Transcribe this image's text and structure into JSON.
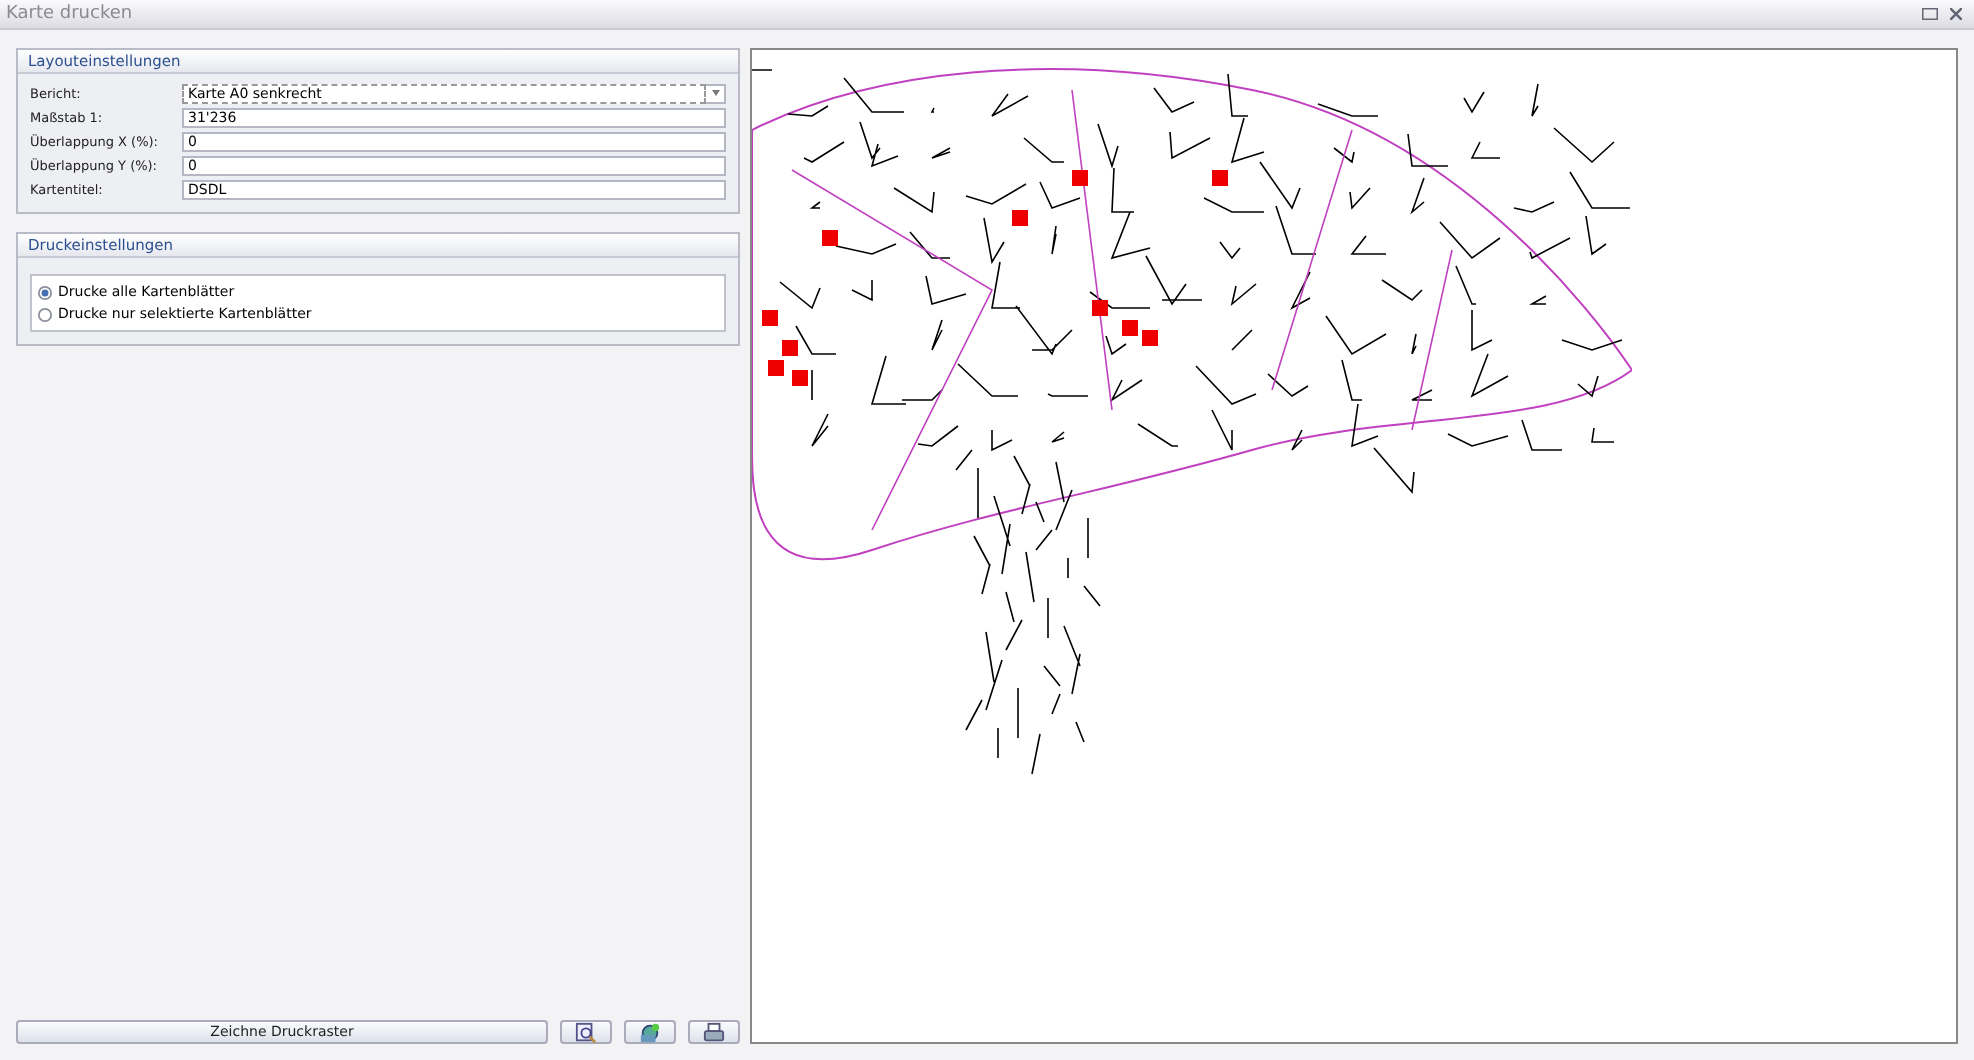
{
  "window": {
    "title": "Karte drucken"
  },
  "layout_settings": {
    "title": "Layouteinstellungen",
    "fields": [
      {
        "kind": "dropdown",
        "label": "Bericht:",
        "value": "Karte A0 senkrecht"
      },
      {
        "kind": "text",
        "label": "Maßstab 1:",
        "value": "31'236"
      },
      {
        "kind": "text",
        "label": "Überlappung X (%):",
        "value": "0"
      },
      {
        "kind": "text",
        "label": "Überlappung Y (%):",
        "value": "0"
      },
      {
        "kind": "text",
        "label": "Kartentitel:",
        "value": "DSDL"
      }
    ]
  },
  "print_settings": {
    "title": "Druckeinstellungen",
    "options": [
      {
        "label": "Drucke alle Kartenblätter",
        "selected": true
      },
      {
        "label": "Drucke nur selektierte Kartenblätter",
        "selected": false
      }
    ]
  },
  "buttons": [
    {
      "kind": "text",
      "label": "Zeichne Druckraster"
    },
    {
      "kind": "zoom"
    },
    {
      "kind": "globe"
    },
    {
      "kind": "print"
    }
  ]
}
